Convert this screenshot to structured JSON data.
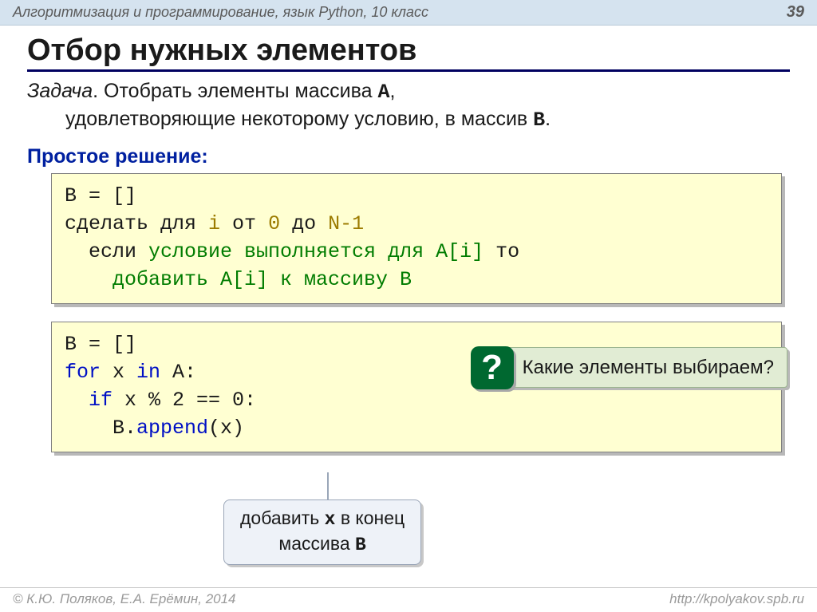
{
  "header": {
    "breadcrumb": "Алгоритмизация и программирование, язык Python, 10 класс",
    "page_number": "39"
  },
  "title": "Отбор нужных элементов",
  "task": {
    "label": "Задача",
    "line1_a": ". Отобрать элементы массива ",
    "line1_mono": "A",
    "line1_b": ",",
    "line2_a": "удовлетворяющие некоторому условию, в массив ",
    "line2_mono": "B",
    "line2_b": "."
  },
  "subhead": "Простое решение:",
  "code1": {
    "l1": "B = []",
    "l2_a": "сделать для ",
    "l2_i": "i",
    "l2_b": " от ",
    "l2_zero": "0",
    "l2_c": " до ",
    "l2_n": "N-1",
    "l3_a": "если ",
    "l3_cond": "условие выполняется для A[i]",
    "l3_b": " то",
    "l4": "добавить A[i] к массиву B"
  },
  "code2": {
    "l1": "B = []",
    "l2_for": "for",
    "l2_x": " x ",
    "l2_in": "in",
    "l2_a": " A:",
    "l3_if": "if",
    "l3_body": " x % 2 == 0:",
    "l4_a": "B.",
    "l4_app": "append",
    "l4_b": "(x)"
  },
  "callout": {
    "mark": "?",
    "text": "Какие элементы выбираем?"
  },
  "note": {
    "line1_a": "добавить ",
    "line1_x": "x",
    "line1_b": " в конец",
    "line2_a": "массива ",
    "line2_b": "B"
  },
  "footer": {
    "left": "© К.Ю. Поляков, Е.А. Ерёмин, 2014",
    "right": "http://kpolyakov.spb.ru"
  }
}
